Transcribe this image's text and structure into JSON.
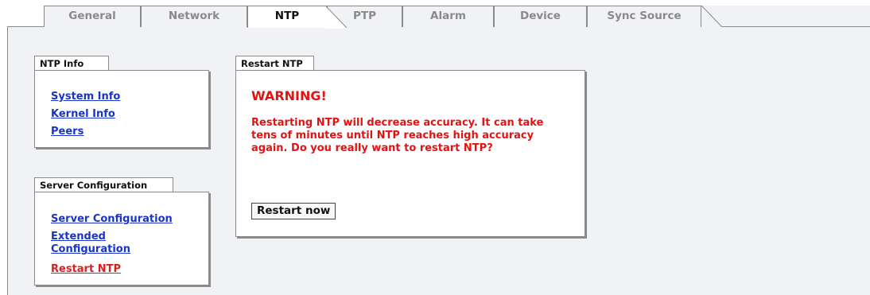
{
  "tabs": [
    {
      "label": "General"
    },
    {
      "label": "Network"
    },
    {
      "label": "NTP"
    },
    {
      "label": "PTP"
    },
    {
      "label": "Alarm"
    },
    {
      "label": "Device"
    },
    {
      "label": "Sync Source"
    }
  ],
  "active_tab": "NTP",
  "ntp_info": {
    "title": "NTP Info",
    "links": [
      {
        "label": "System Info"
      },
      {
        "label": "Kernel Info"
      },
      {
        "label": "Peers"
      }
    ]
  },
  "server_config": {
    "title": "Server Configuration",
    "links": [
      {
        "label": "Server Configuration"
      },
      {
        "label": "Extended Configuration"
      },
      {
        "label": "Restart NTP"
      }
    ]
  },
  "restart": {
    "title": "Restart NTP",
    "warning_title": "WARNING!",
    "warning_text": "Restarting NTP will decrease accuracy. It can take tens of minutes until NTP reaches high accuracy again. Do you really want to restart NTP?",
    "button_label": "Restart now"
  },
  "colors": {
    "link": "#1a34c8",
    "warning": "#e51212",
    "background": "#f0f2f6"
  }
}
